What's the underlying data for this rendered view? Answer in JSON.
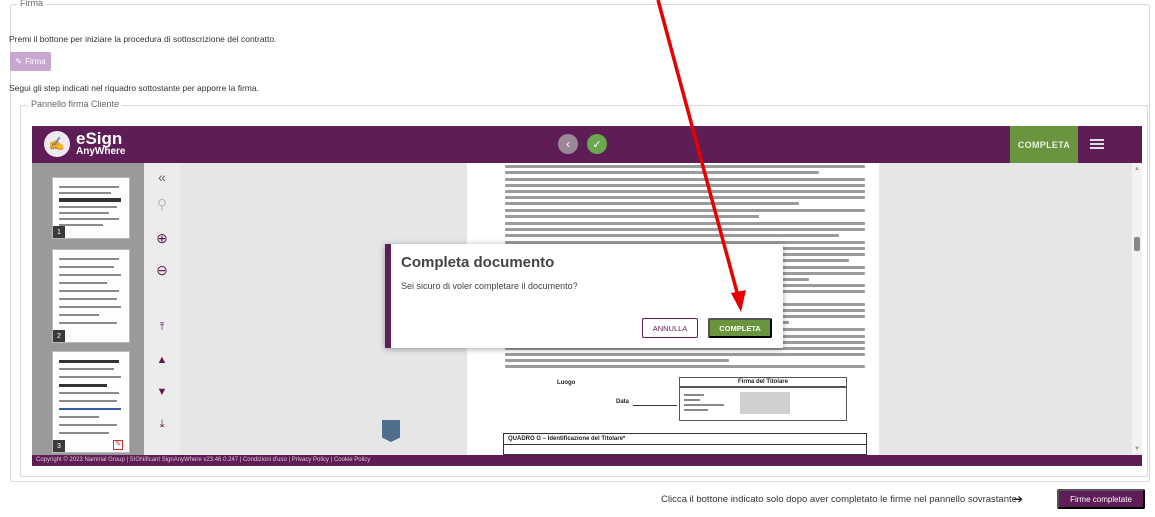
{
  "firma_section": {
    "legend": "Firma",
    "instruction": "Premi il bottone per iniziare la procedura di sottoscrizione del contratto.",
    "button_label": "Firma",
    "step_instruction": "Segui gli step indicati nel riquadro sottostante per apporre la firma."
  },
  "panel": {
    "legend": "Pannello firma Cliente"
  },
  "app": {
    "logo_line1": "eSign",
    "logo_line2": "AnyWhere",
    "complete_label": "COMPLETA",
    "footer": "Copyright © 2023 Namirial Group | SIGNificant SignAnyWhere v23.46.0.247 | Condizioni d'uso | Privacy Policy | Cookie Policy",
    "thumb_numbers": [
      "1",
      "2",
      "3"
    ],
    "colors": {
      "brand": "#5e1d56",
      "green": "#69953e"
    }
  },
  "document": {
    "row_labels": {
      "luogo": "Luogo",
      "data": "Data",
      "firma_titolare": "Firma del Titolare"
    },
    "section_title": "QUADRO G – Identificazione del Titolare*"
  },
  "modal": {
    "title": "Completa documento",
    "message": "Sei sicuro di voler completare il documento?",
    "cancel_label": "ANNULLA",
    "confirm_label": "COMPLETA"
  },
  "bottom": {
    "hint": "Clicca il bottone indicato solo dopo aver completato le firme nel pannello sovrastante",
    "button_label": "Firme completate"
  }
}
